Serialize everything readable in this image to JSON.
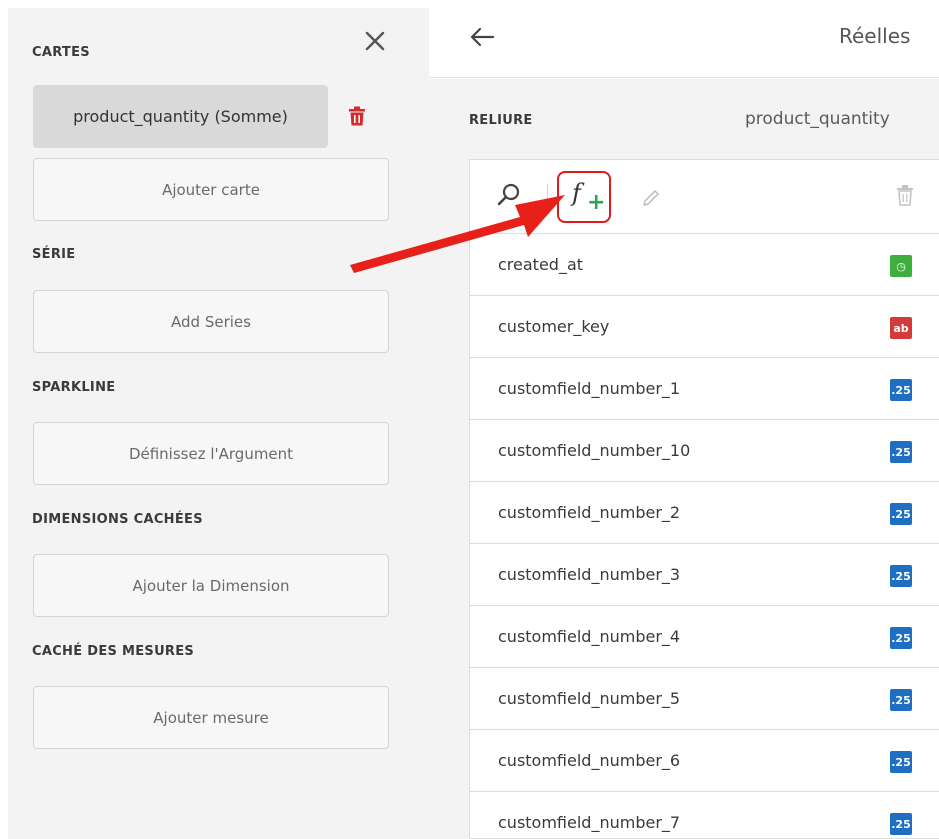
{
  "left_panel": {
    "cards_title": "CARTES",
    "card_chip": "product_quantity (Somme)",
    "add_card": "Ajouter carte",
    "series_title": "SÉRIE",
    "add_series": "Add Series",
    "sparkline_title": "SPARKLINE",
    "sparkline_placeholder": "Définissez l'Argument",
    "hidden_dimensions_title": "DIMENSIONS CACHÉES",
    "add_dimension": "Ajouter la Dimension",
    "hidden_measures_title": "CACHÉ DES MESURES",
    "add_measure": "Ajouter mesure"
  },
  "top_bar": {
    "title": "Réelles"
  },
  "binding": {
    "label": "RELIURE",
    "value": "product_quantity"
  },
  "fields": [
    {
      "name": "created_at",
      "type": "date",
      "badge": "◷"
    },
    {
      "name": "customer_key",
      "type": "text",
      "badge": "ab"
    },
    {
      "name": "customfield_number_1",
      "type": "number",
      "badge": ".25"
    },
    {
      "name": "customfield_number_10",
      "type": "number",
      "badge": ".25"
    },
    {
      "name": "customfield_number_2",
      "type": "number",
      "badge": ".25"
    },
    {
      "name": "customfield_number_3",
      "type": "number",
      "badge": ".25"
    },
    {
      "name": "customfield_number_4",
      "type": "number",
      "badge": ".25"
    },
    {
      "name": "customfield_number_5",
      "type": "number",
      "badge": ".25"
    },
    {
      "name": "customfield_number_6",
      "type": "number",
      "badge": ".25"
    },
    {
      "name": "customfield_number_7",
      "type": "number",
      "badge": ".25"
    }
  ],
  "toolbar": {
    "fx_label": "f",
    "fx_plus": "+"
  },
  "colors": {
    "highlight": "#e11a1a",
    "arrow": "#e8201a",
    "date_badge": "#3fae3f",
    "text_badge": "#d33b3b",
    "number_badge": "#1e6ec2"
  }
}
